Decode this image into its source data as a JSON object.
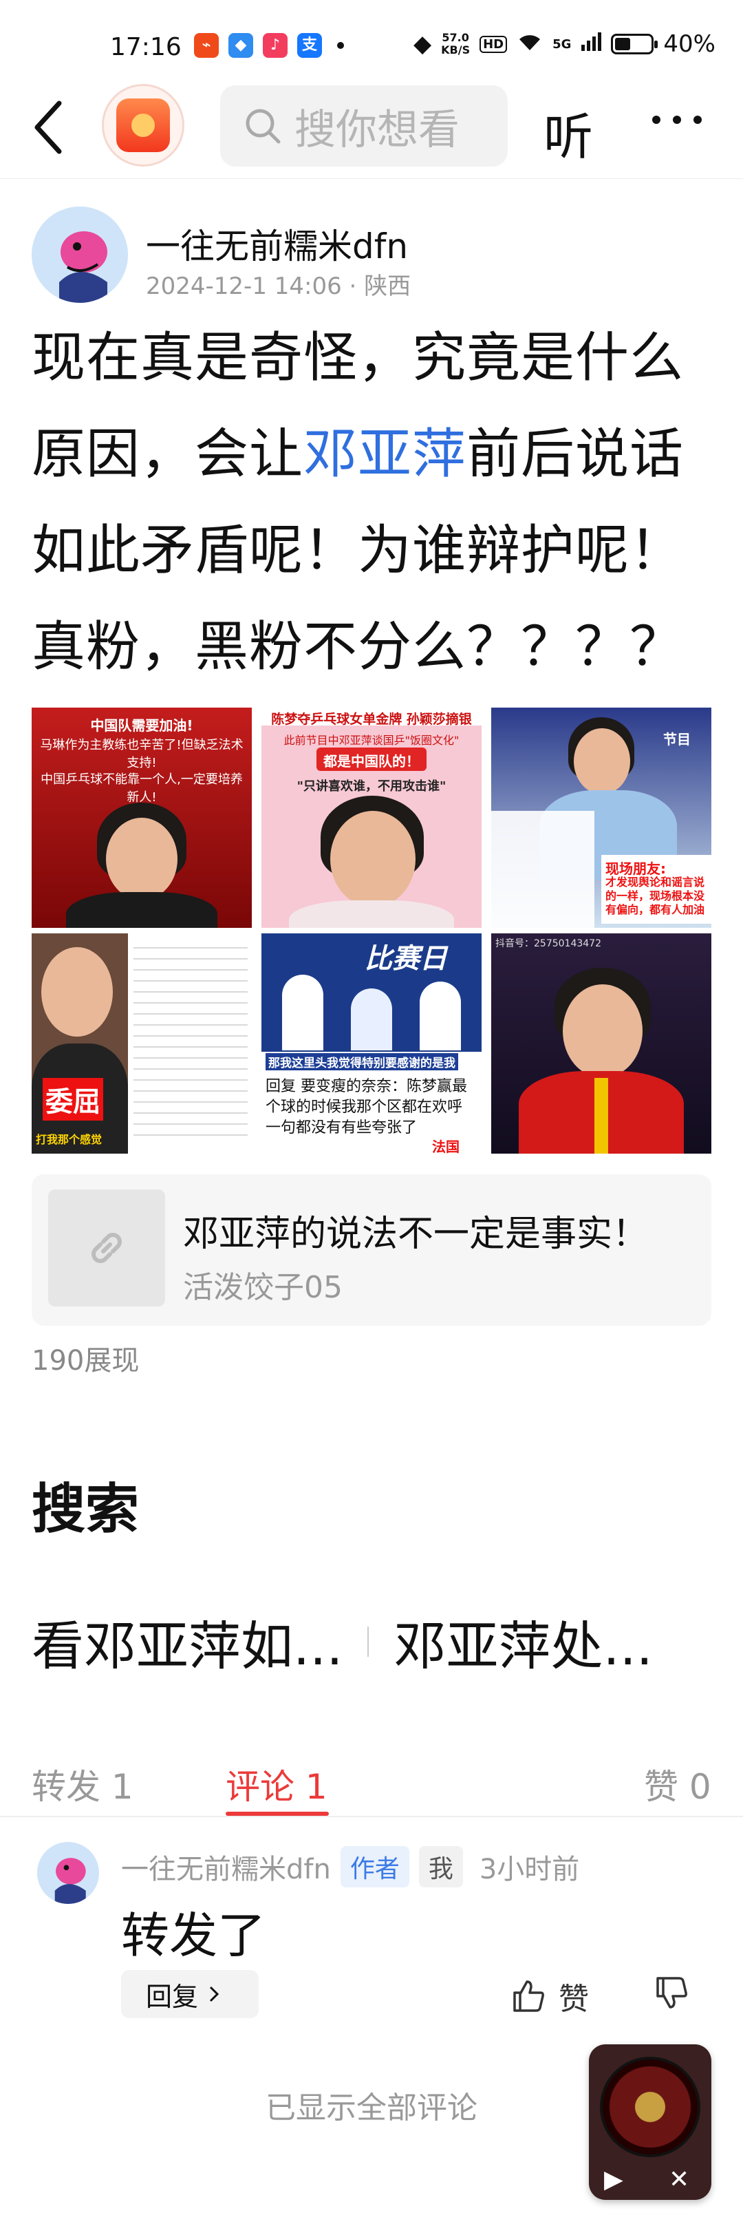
{
  "status_bar": {
    "time": "17:16",
    "speed_value": "57.0",
    "speed_unit": "KB/S",
    "hd": "HD",
    "network": "5G",
    "battery": "40%",
    "battery_level": 0.4
  },
  "header": {
    "search_placeholder": "搜你想看",
    "listen_label": "听"
  },
  "author": {
    "name": "一往无前糯米dfn",
    "datetime": "2024-12-1 14:06",
    "location": "陕西"
  },
  "post": {
    "text_before": "现在真是奇怪，究竟是什么原因，会让",
    "link": "邓亚萍",
    "text_after": "前后说话如此矛盾呢！为谁辩护呢！真粉，黑粉不分么？？？？"
  },
  "images": {
    "img1": {
      "cap1": "中国队需要加油!",
      "cap2": "马琳作为主教练也辛苦了!但缺乏法术支持!",
      "cap3": "中国乒乓球不能靠一个人,一定要培养新人!"
    },
    "img2": {
      "banner": "陈梦夺乒乓球女单金牌 孙颖莎摘银",
      "sub": "此前节目中邓亚萍谈国乒\"饭圈文化\"",
      "q1": "都是中国队的！",
      "q2": "\"只讲喜欢谁，不用攻击谁\""
    },
    "img3": {
      "label": "节目",
      "note": "现场朋友:",
      "text": "才发现舆论和谣言说的一样，现场根本没有偏向，都有人加油"
    },
    "img4": {
      "tag": "委屈",
      "bottom": "打我那个感觉"
    },
    "img5": {
      "title": "比赛日",
      "banner": "那我这里头我觉得特别要感谢的是我",
      "line1": "回复  要变瘦的奈奈：陈梦赢最",
      "line2": "个球的时候我那个区都在欢呼",
      "line3": "一句都没有有些夸张了",
      "tag": "法国"
    },
    "img6": {
      "id": "抖音号：25750143472"
    }
  },
  "link_card": {
    "title": "邓亚萍的说法不一定是事实！",
    "source": "活泼饺子05"
  },
  "views": "190展现",
  "search_section": {
    "title": "搜索",
    "suggestions": [
      "看邓亚萍如...",
      "邓亚萍处..."
    ]
  },
  "tabs": [
    {
      "label": "转发 1"
    },
    {
      "label": "评论 1"
    },
    {
      "label": "赞 0"
    }
  ],
  "comment": {
    "name": "一往无前糯米dfn",
    "badge_author": "作者",
    "badge_me": "我",
    "time": "3小时前",
    "body": "转发了",
    "reply_label": "回复",
    "like_label": "赞"
  },
  "footer": {
    "all_shown": "已显示全部评论"
  },
  "colors": {
    "accent_red": "#ec3a3a",
    "link_blue": "#2f6fdf"
  }
}
